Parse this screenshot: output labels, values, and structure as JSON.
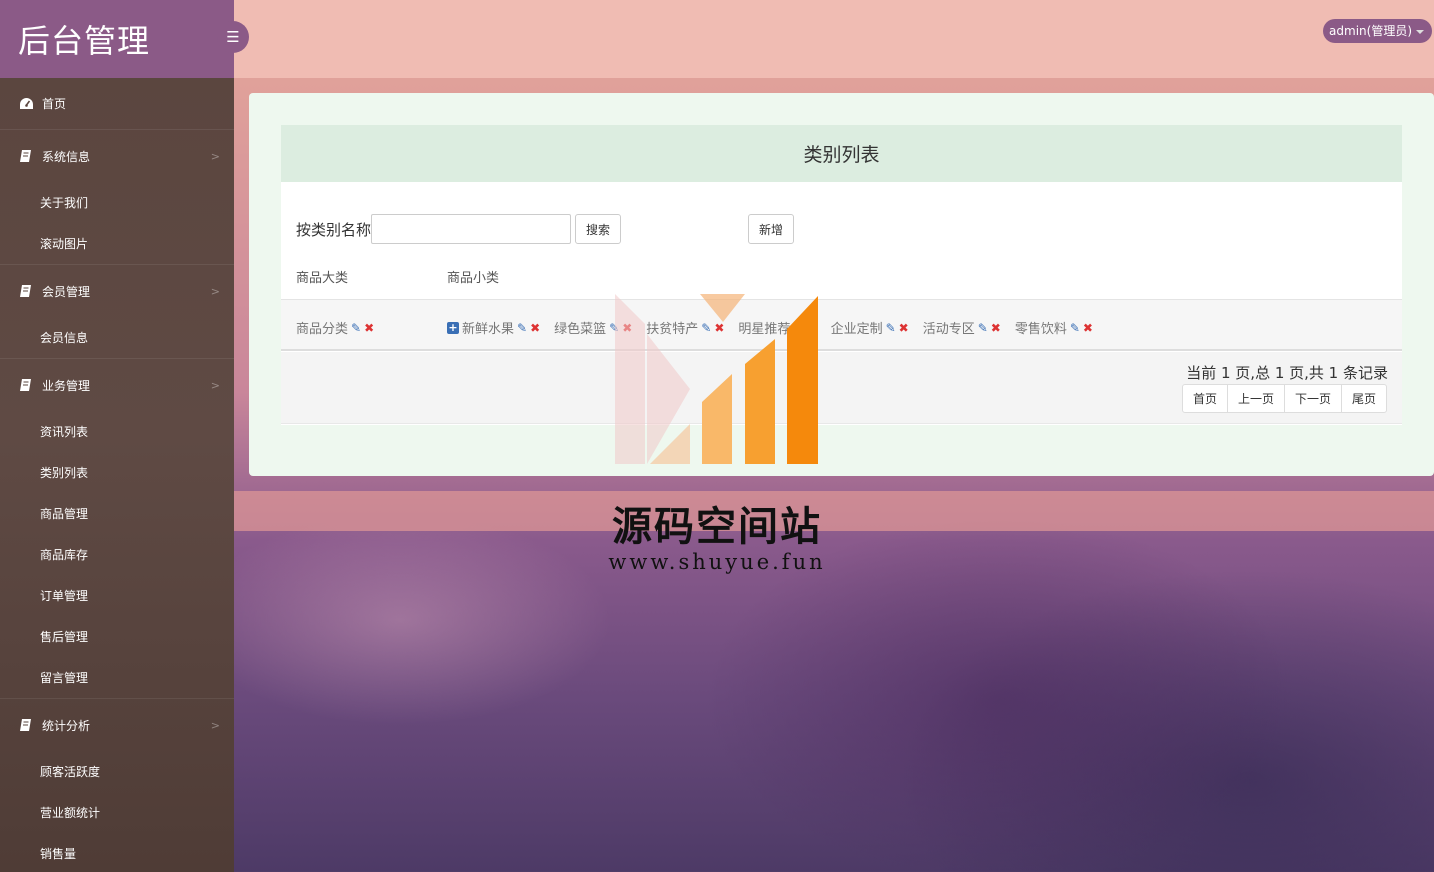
{
  "brand": {
    "title": "后台管理"
  },
  "header": {
    "toggle_icon": "☰",
    "user_label": "admin(管理员)"
  },
  "sidebar": {
    "home": {
      "label": "首页"
    },
    "groups": [
      {
        "label": "系统信息",
        "items": [
          {
            "label": "关于我们"
          },
          {
            "label": "滚动图片"
          }
        ]
      },
      {
        "label": "会员管理",
        "items": [
          {
            "label": "会员信息"
          }
        ]
      },
      {
        "label": "业务管理",
        "items": [
          {
            "label": "资讯列表"
          },
          {
            "label": "类别列表"
          },
          {
            "label": "商品管理"
          },
          {
            "label": "商品库存"
          },
          {
            "label": "订单管理"
          },
          {
            "label": "售后管理"
          },
          {
            "label": "留言管理"
          }
        ]
      },
      {
        "label": "统计分析",
        "items": [
          {
            "label": "顾客活跃度"
          },
          {
            "label": "营业额统计"
          },
          {
            "label": "销售量"
          }
        ]
      }
    ]
  },
  "panel": {
    "title": "类别列表",
    "search_label": "按类别名称",
    "search_value": "",
    "search_button": "搜索",
    "add_button": "新增",
    "col_major": "商品大类",
    "col_minor": "商品小类"
  },
  "rows": [
    {
      "major": "商品分类",
      "minors": [
        {
          "label": "新鲜水果"
        },
        {
          "label": "绿色菜篮"
        },
        {
          "label": "扶贫特产"
        },
        {
          "label": "明星推荐"
        },
        {
          "label": "企业定制"
        },
        {
          "label": "活动专区"
        },
        {
          "label": "零售饮料"
        }
      ]
    }
  ],
  "pager": {
    "info": "当前 1 页,总 1 页,共 1 条记录",
    "first": "首页",
    "prev": "上一页",
    "next": "下一页",
    "last": "尾页"
  },
  "watermark": {
    "title": "源码空间站",
    "url": "www.shuyue.fun"
  },
  "colors": {
    "brand": "#8b5a87",
    "topbar": "#f0bcb3",
    "panel_head": "#dcede0",
    "edit": "#3a6fb5",
    "delete": "#dd3333"
  }
}
